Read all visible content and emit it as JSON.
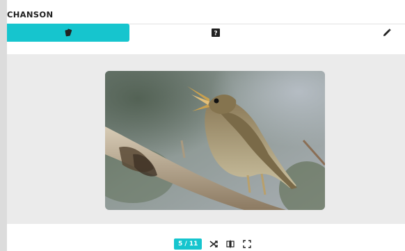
{
  "header": {
    "title": "CHANSON"
  },
  "tabs": [
    {
      "icon": "cards-icon",
      "active": true
    },
    {
      "icon": "help-icon",
      "active": false
    },
    {
      "icon": "pencil-icon",
      "active": false
    }
  ],
  "viewer": {
    "image_alt": "bird-photo"
  },
  "footer": {
    "counter": "5 / 11",
    "controls": [
      "shuffle-icon",
      "split-view-icon",
      "fullscreen-icon"
    ]
  },
  "colors": {
    "accent": "#16c5ce",
    "stage_bg": "#ebebeb"
  }
}
